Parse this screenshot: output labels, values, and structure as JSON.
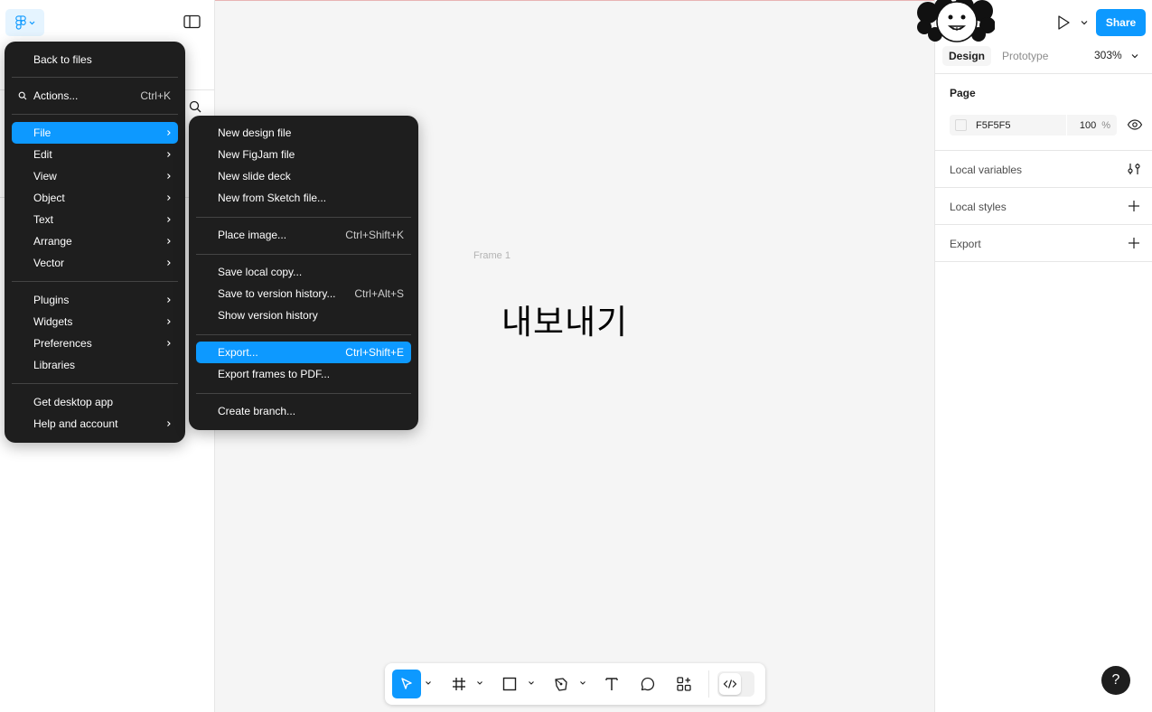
{
  "canvas": {
    "frame_label": "Frame 1",
    "text": "내보내기"
  },
  "right_panel": {
    "share": "Share",
    "tabs": {
      "design": "Design",
      "prototype": "Prototype"
    },
    "zoom": "303%",
    "page": {
      "title": "Page",
      "color_hex": "F5F5F5",
      "opacity": "100",
      "opacity_unit": "%"
    },
    "local_variables": "Local variables",
    "local_styles": "Local styles",
    "export": "Export"
  },
  "main_menu": {
    "back_to_files": "Back to files",
    "actions": {
      "label": "Actions...",
      "shortcut": "Ctrl+K"
    },
    "file": "File",
    "edit": "Edit",
    "view": "View",
    "object": "Object",
    "text": "Text",
    "arrange": "Arrange",
    "vector": "Vector",
    "plugins": "Plugins",
    "widgets": "Widgets",
    "preferences": "Preferences",
    "libraries": "Libraries",
    "get_desktop_app": "Get desktop app",
    "help_and_account": "Help and account"
  },
  "file_menu": {
    "new_design_file": "New design file",
    "new_figjam_file": "New FigJam file",
    "new_slide_deck": "New slide deck",
    "new_from_sketch": "New from Sketch file...",
    "place_image": {
      "label": "Place image...",
      "shortcut": "Ctrl+Shift+K"
    },
    "save_local_copy": "Save local copy...",
    "save_version_history": {
      "label": "Save to version history...",
      "shortcut": "Ctrl+Alt+S"
    },
    "show_version_history": "Show version history",
    "export": {
      "label": "Export...",
      "shortcut": "Ctrl+Shift+E"
    },
    "export_frames_pdf": "Export frames to PDF...",
    "create_branch": "Create branch..."
  },
  "help": "?",
  "colors": {
    "accent": "#0d99ff",
    "menu_bg": "#1e1e1e",
    "canvas_bg": "#f5f5f5"
  }
}
